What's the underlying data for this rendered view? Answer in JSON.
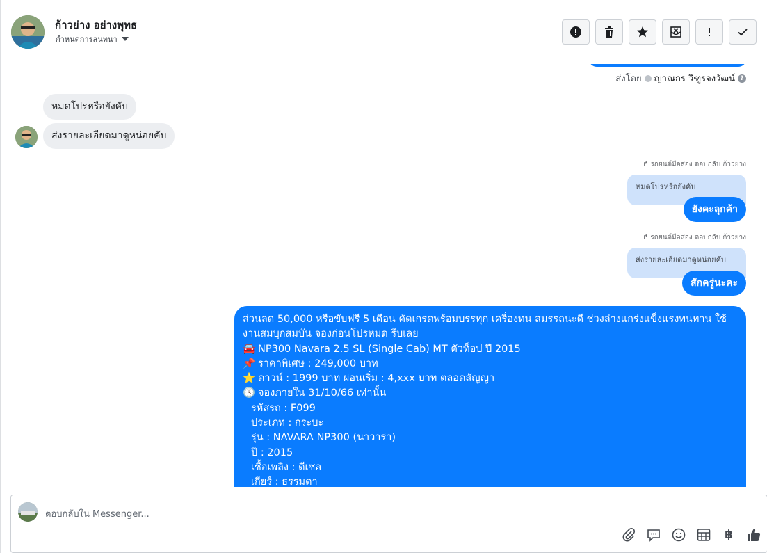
{
  "header": {
    "contact_name": "ก้าวย่าง อย่างพุทธ",
    "assign_label": "กำหนดการสนทนา",
    "actions": [
      {
        "name": "report-spam-button",
        "icon": "alert-circle-icon"
      },
      {
        "name": "delete-button",
        "icon": "trash-icon"
      },
      {
        "name": "star-button",
        "icon": "star-icon"
      },
      {
        "name": "mark-unread-button",
        "icon": "envelope-x-icon"
      },
      {
        "name": "follow-up-button",
        "icon": "exclamation-icon"
      },
      {
        "name": "mark-done-button",
        "icon": "check-icon"
      }
    ]
  },
  "conversation": {
    "sent_by_prefix": "ส่งโดย",
    "sent_by_agent": "ญาณกร วิฑูรจงวัฒน์",
    "incoming": [
      {
        "text": "หมดโปรหรือยังคับ"
      },
      {
        "text": "ส่งรายละเอียดมาดูหน่อยคับ"
      }
    ],
    "replies": [
      {
        "meta": "รถยนต์มือสอง ตอบกลับ ก้าวย่าง",
        "quoted": "หมดโปรหรือยังคับ",
        "text": "ยังคะลุกค้า"
      },
      {
        "meta": "รถยนต์มือสอง ตอบกลับ ก้าวย่าง",
        "quoted": "ส่งรายละเอียดมาดูหน่อยคับ",
        "text": "สักครู่นะคะ"
      }
    ],
    "promo": {
      "intro": "ส่วนลด 50,000 หรือขับฟรี 5 เดือน คัดเกรดพร้อมบรรทุก เครื่องทน สมรรถนะดี ช่วงล่างแกร่งแข็งแรงทนทาน ใช้งานสมบุกสมบัน จองก่อนโปรหมด รีบเลย",
      "lines": [
        {
          "emoji": "🚘",
          "text": "NP300 Navara 2.5 SL (Single Cab) MT ตัวท็อป ปี 2015"
        },
        {
          "emoji": "📌",
          "text": "ราคาพิเศษ : 249,000 บาท"
        },
        {
          "emoji": "⭐",
          "text": "ดาวน์ : 1999 บาท ผ่อนเริ่ม : 4,xxx บาท ตลอดสัญญา"
        },
        {
          "emoji": "🕓",
          "text": "จองภายใน 31/10/66 เท่านั้น"
        }
      ],
      "specs": [
        "รหัสรถ : F099",
        "ประเภท : กระบะ",
        "รุ่น : NAVARA NP300 (นาวาร่า)",
        "ปี : 2015",
        "เชื้อเพลิง : ดีเซล",
        "เกียร์ : ธรรมดา"
      ]
    }
  },
  "composer": {
    "placeholder": "ตอบกลับใน Messenger...",
    "tools": [
      "paperclip-icon",
      "saved-reply-icon",
      "emoji-icon",
      "table-icon",
      "baht-icon",
      "like-icon"
    ],
    "currency_symbol": "฿"
  },
  "colors": {
    "outgoing": "#0a7cff",
    "quote": "#cfe2fb",
    "incoming": "#eceef1"
  }
}
